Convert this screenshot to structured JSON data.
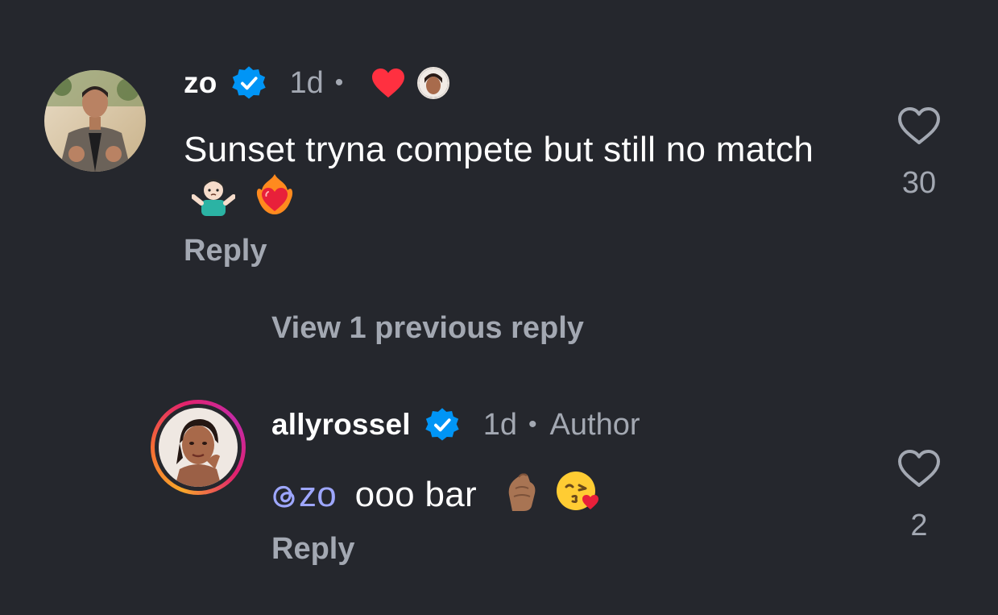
{
  "comments": [
    {
      "username": "zo",
      "timestamp": "1d",
      "separator": "•",
      "text": "Sunset tryna compete but still no match",
      "emojis": [
        "person-shrugging-emoji",
        "heart-on-fire-emoji"
      ],
      "liked_by_author": true,
      "reply_label": "Reply",
      "like_count": "30"
    },
    {
      "username": "allyrossel",
      "timestamp": "1d",
      "separator": "•",
      "author_label": "Author",
      "mention": "zo",
      "text": "ooo bar",
      "emojis": [
        "pinched-fingers-emoji",
        "face-blowing-kiss-emoji"
      ],
      "reply_label": "Reply",
      "like_count": "2"
    }
  ],
  "thread": {
    "view_previous_label": "View 1 previous reply"
  },
  "colors": {
    "background": "#25272d",
    "secondary_text": "#a3a8b2",
    "verified_blue": "#0095f6",
    "liked_red": "#ff3040",
    "mention": "#9ea7ff"
  }
}
